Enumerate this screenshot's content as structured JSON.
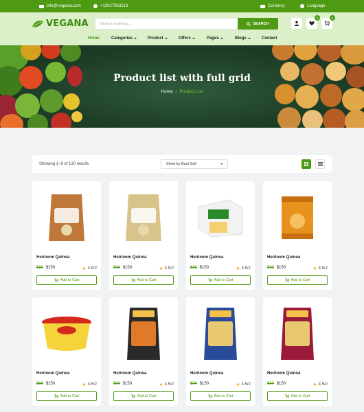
{
  "topbar": {
    "email": "info@vegania.com",
    "phone": "+12027953213",
    "currency": "Currency",
    "language": "Language"
  },
  "header": {
    "logo": "VEGANA",
    "search_placeholder": "Search anything....",
    "search_button": "SEARCH",
    "wishlist_count": "0",
    "cart_count": "0"
  },
  "nav": {
    "items": [
      {
        "label": "Home",
        "active": true
      },
      {
        "label": "Categories"
      },
      {
        "label": "Product"
      },
      {
        "label": "Offers"
      },
      {
        "label": "Pages"
      },
      {
        "label": "Blogs"
      },
      {
        "label": "Contact"
      }
    ]
  },
  "hero": {
    "title": "Product list with full grid",
    "breadcrumb_home": "Home",
    "breadcrumb_sep": "/",
    "breadcrumb_current": "Product List"
  },
  "toolbar": {
    "showing": "Showing 1–9 of 130 results",
    "sort": "Short by Best Sell"
  },
  "products": [
    {
      "name": "Heirloom Quinoa",
      "old_price": "$80",
      "price": "$150",
      "rating": "4.5/2",
      "cta": "Add to Cart",
      "pkg": "bag",
      "pkg_color": "#c0783a",
      "pkg_label": "HEIRLOOM QUINOA"
    },
    {
      "name": "Heirloom Quinoa",
      "old_price": "$60",
      "price": "$150",
      "rating": "4.5/2",
      "cta": "Add to Cart",
      "pkg": "bag",
      "pkg_color": "#d8c48a",
      "pkg_label": "BULGUR"
    },
    {
      "name": "Heirloom Quinoa",
      "old_price": "$80",
      "price": "$150",
      "rating": "4.5/2",
      "cta": "Add to Cart",
      "pkg": "box",
      "pkg_color": "#f2f2f2",
      "pkg_label": "TOFU"
    },
    {
      "name": "Heirloom Quinoa",
      "old_price": "$60",
      "price": "$150",
      "rating": "4.5/2",
      "cta": "Add to Cart",
      "pkg": "can",
      "pkg_color": "#e8921e",
      "pkg_label": "Tempeh"
    },
    {
      "name": "Heirloom Quinoa",
      "old_price": "$80",
      "price": "$150",
      "rating": "4.5/2",
      "cta": "Add to Cart",
      "pkg": "tub",
      "pkg_color": "#f4d43a",
      "pkg_label": "HUMMUS"
    },
    {
      "name": "Heirloom Quinoa",
      "old_price": "$60",
      "price": "$150",
      "rating": "4.5/2",
      "cta": "Add to Cart",
      "pkg": "pouch",
      "pkg_color": "#2a2a2a",
      "pkg_label": "RED LENTILS"
    },
    {
      "name": "Heirloom Quinoa",
      "old_price": "$80",
      "price": "$150",
      "rating": "4.5/2",
      "cta": "Add to Cart",
      "pkg": "pouch",
      "pkg_color": "#2a4a9a",
      "pkg_label": "DIAMOND"
    },
    {
      "name": "Heirloom Quinoa",
      "old_price": "$80",
      "price": "$150",
      "rating": "4.5/2",
      "cta": "Add to Cart",
      "pkg": "pouch",
      "pkg_color": "#9a1a3a",
      "pkg_label": ""
    }
  ],
  "colors": {
    "brand": "#4e9a13",
    "header_bg": "#dbf0c8",
    "star": "#f2b01e"
  }
}
